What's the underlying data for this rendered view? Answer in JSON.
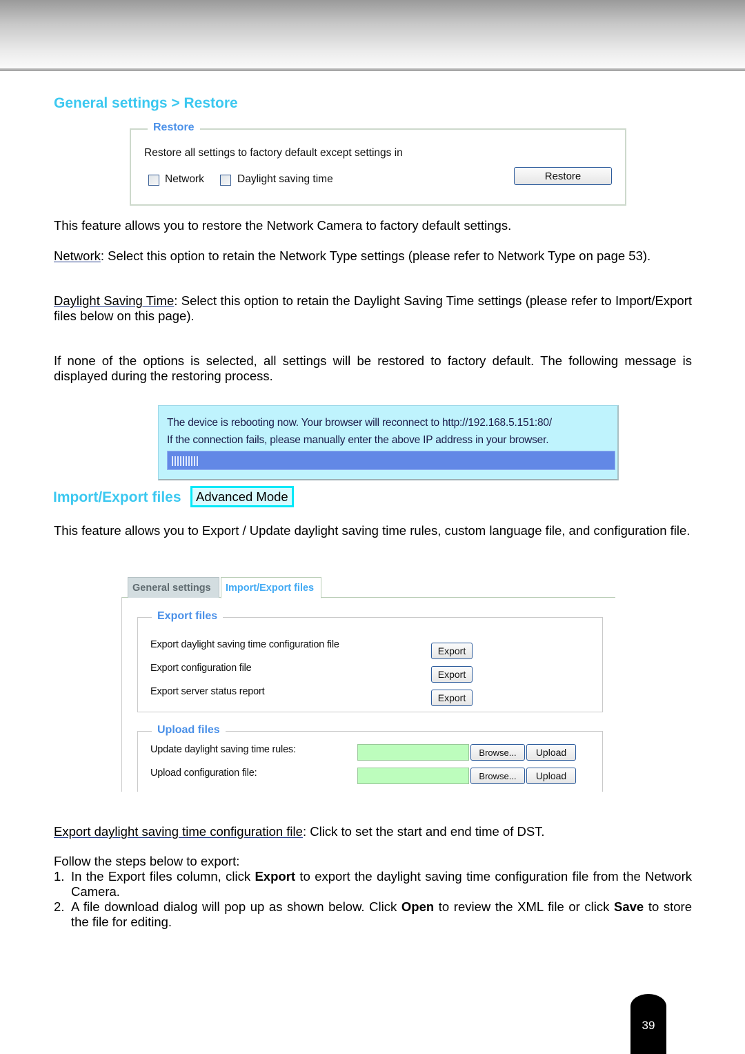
{
  "page_number": "39",
  "sections": {
    "restore_heading": "General settings > Restore",
    "import_export_heading": "Import/Export files",
    "advanced_mode_tag": "Advanced Mode"
  },
  "restore_panel": {
    "legend": "Restore",
    "description": "Restore all settings to factory default except settings in",
    "options": [
      {
        "label": "Network",
        "checked": false
      },
      {
        "label": "Daylight saving time",
        "checked": false
      }
    ],
    "restore_button": "Restore"
  },
  "restore_text": {
    "intro": "This feature allows you to restore the Network Camera to factory default settings.",
    "network_term": "Network",
    "network_desc": ": Select this option to retain the Network Type settings (please refer to Network Type on page 53).",
    "dst_term": "Daylight Saving Time",
    "dst_desc": ": Select this option to retain the Daylight Saving Time settings (please refer to Import/Export files below on this page).",
    "none_selected": "If none of the options is selected, all settings will be restored to factory default.  The following message is displayed during the restoring process."
  },
  "reboot_message": {
    "line1": "The device is rebooting now. Your browser will reconnect to http://192.168.5.151:80/",
    "line2": "If the connection fails, please manually enter the above IP address in your browser.",
    "progress_ticks": 10
  },
  "import_export_text": {
    "intro": "This feature allows you to Export / Update daylight saving time rules, custom language file, and configuration file."
  },
  "import_export_panel": {
    "tabs": [
      {
        "label": "General settings",
        "active": false
      },
      {
        "label": "Import/Export files",
        "active": true
      }
    ],
    "export_legend": "Export files",
    "export_rows": [
      {
        "label": "Export daylight saving time configuration file",
        "button": "Export"
      },
      {
        "label": "Export configuration file",
        "button": "Export"
      },
      {
        "label": "Export server status report",
        "button": "Export"
      }
    ],
    "upload_legend": "Upload files",
    "upload_rows": [
      {
        "label": "Update daylight saving time rules:",
        "value": "",
        "browse": "Browse...",
        "upload": "Upload"
      },
      {
        "label": "Upload configuration file:",
        "value": "",
        "browse": "Browse...",
        "upload": "Upload"
      }
    ]
  },
  "export_text": {
    "term": "Export daylight saving time configuration file",
    "term_desc": ": Click to set the start and end time of DST.",
    "steps_intro": "Follow the steps below to export:",
    "step1_num": "1.",
    "step1_a": "In the Export files column, click ",
    "step1_bold": "Export",
    "step1_b": " to export the daylight saving time configuration file from the Network Camera.",
    "step2_num": "2.",
    "step2_a": "A file download dialog will pop up as shown below. Click ",
    "step2_bold1": "Open",
    "step2_b": " to review the XML file or click ",
    "step2_bold2": "Save",
    "step2_c": " to store the file for editing."
  }
}
